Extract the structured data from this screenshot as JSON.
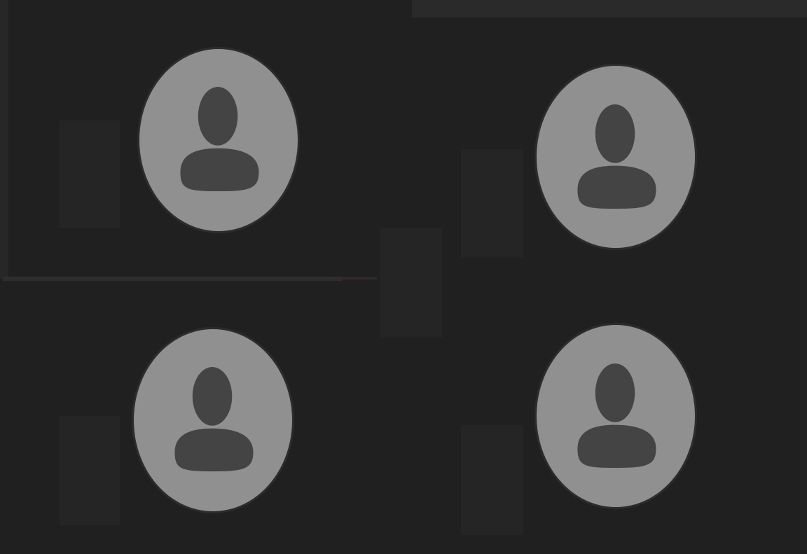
{
  "colors": {
    "background": "#202020",
    "avatar_fill": "#909090",
    "silhouette": "#444444",
    "placeholder_block": "#252525"
  },
  "participants": [
    {
      "avatar_icon": "person-icon",
      "video": "off"
    },
    {
      "avatar_icon": "person-icon",
      "video": "off"
    },
    {
      "avatar_icon": "person-icon",
      "video": "off"
    },
    {
      "avatar_icon": "person-icon",
      "video": "off"
    }
  ]
}
